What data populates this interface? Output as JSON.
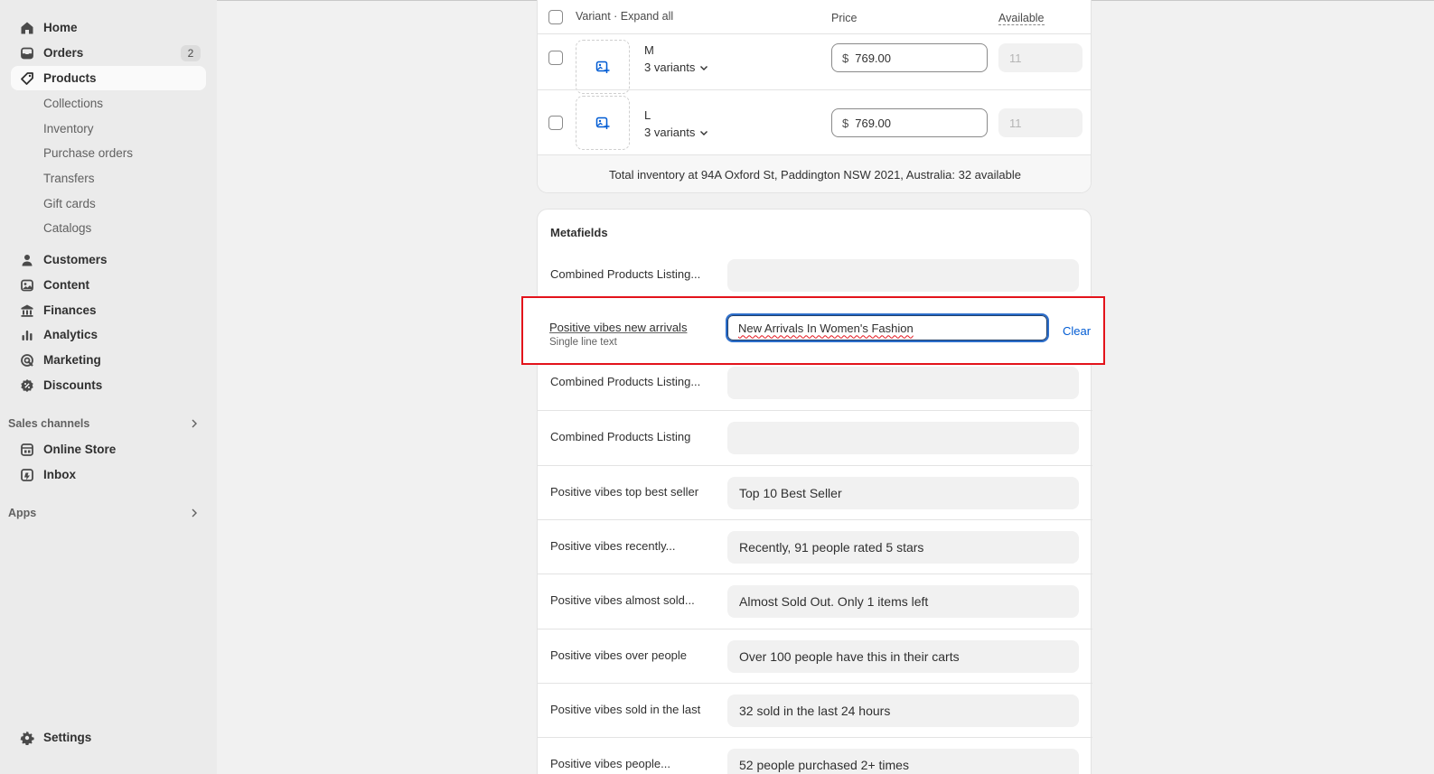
{
  "sidebar": {
    "items": [
      {
        "label": "Home",
        "icon": "home-icon"
      },
      {
        "label": "Orders",
        "icon": "orders-icon",
        "badge": "2"
      },
      {
        "label": "Products",
        "icon": "tag-icon",
        "active": true
      }
    ],
    "product_subitems": [
      "Collections",
      "Inventory",
      "Purchase orders",
      "Transfers",
      "Gift cards",
      "Catalogs"
    ],
    "more_items": [
      {
        "label": "Customers",
        "icon": "person-icon"
      },
      {
        "label": "Content",
        "icon": "content-icon"
      },
      {
        "label": "Finances",
        "icon": "bank-icon"
      },
      {
        "label": "Analytics",
        "icon": "bar-chart-icon"
      },
      {
        "label": "Marketing",
        "icon": "target-icon"
      },
      {
        "label": "Discounts",
        "icon": "discount-icon"
      }
    ],
    "sales_channels_header": "Sales channels",
    "sales_channels": [
      {
        "label": "Online Store",
        "icon": "store-icon"
      },
      {
        "label": "Inbox",
        "icon": "inbox-icon"
      }
    ],
    "apps_header": "Apps",
    "settings_label": "Settings"
  },
  "variants": {
    "header_label": "Variant · Expand all",
    "price_header": "Price",
    "available_header": "Available",
    "rows": [
      {
        "name": "M",
        "count": "3 variants",
        "currency": "$",
        "price": "769.00",
        "available": "11"
      },
      {
        "name": "L",
        "count": "3 variants",
        "currency": "$",
        "price": "769.00",
        "available": "11"
      }
    ],
    "total_inventory": "Total inventory at 94A Oxford St, Paddington NSW 2021, Australia: 32 available"
  },
  "metafields": {
    "title": "Metafields",
    "rows": [
      {
        "label": "Combined Products Listing...",
        "value": ""
      },
      {
        "label": "Combined Products Listing...",
        "value": ""
      },
      {
        "label": "Combined Products Listing",
        "value": ""
      },
      {
        "label": "Positive vibes top best seller",
        "value": "Top 10 Best Seller"
      },
      {
        "label": "Positive vibes recently...",
        "value": "Recently, 91 people rated 5 stars"
      },
      {
        "label": "Positive vibes almost sold...",
        "value": "Almost Sold Out. Only 1 items left"
      },
      {
        "label": "Positive vibes over people",
        "value": "Over 100 people have this in their carts"
      },
      {
        "label": "Positive vibes sold in the last",
        "value": "32 sold in the last 24 hours"
      },
      {
        "label": "Positive vibes people...",
        "value": "52 people purchased 2+ times"
      }
    ],
    "active": {
      "label": "Positive vibes new arrivals",
      "type": "Single line text",
      "value": "New Arrivals In Women's Fashion",
      "clear_label": "Clear"
    }
  },
  "colors": {
    "highlight_border": "#e3131b",
    "focus_ring": "#2c6ecb",
    "link": "#005bd3",
    "sidebar_bg": "#ebebeb"
  }
}
